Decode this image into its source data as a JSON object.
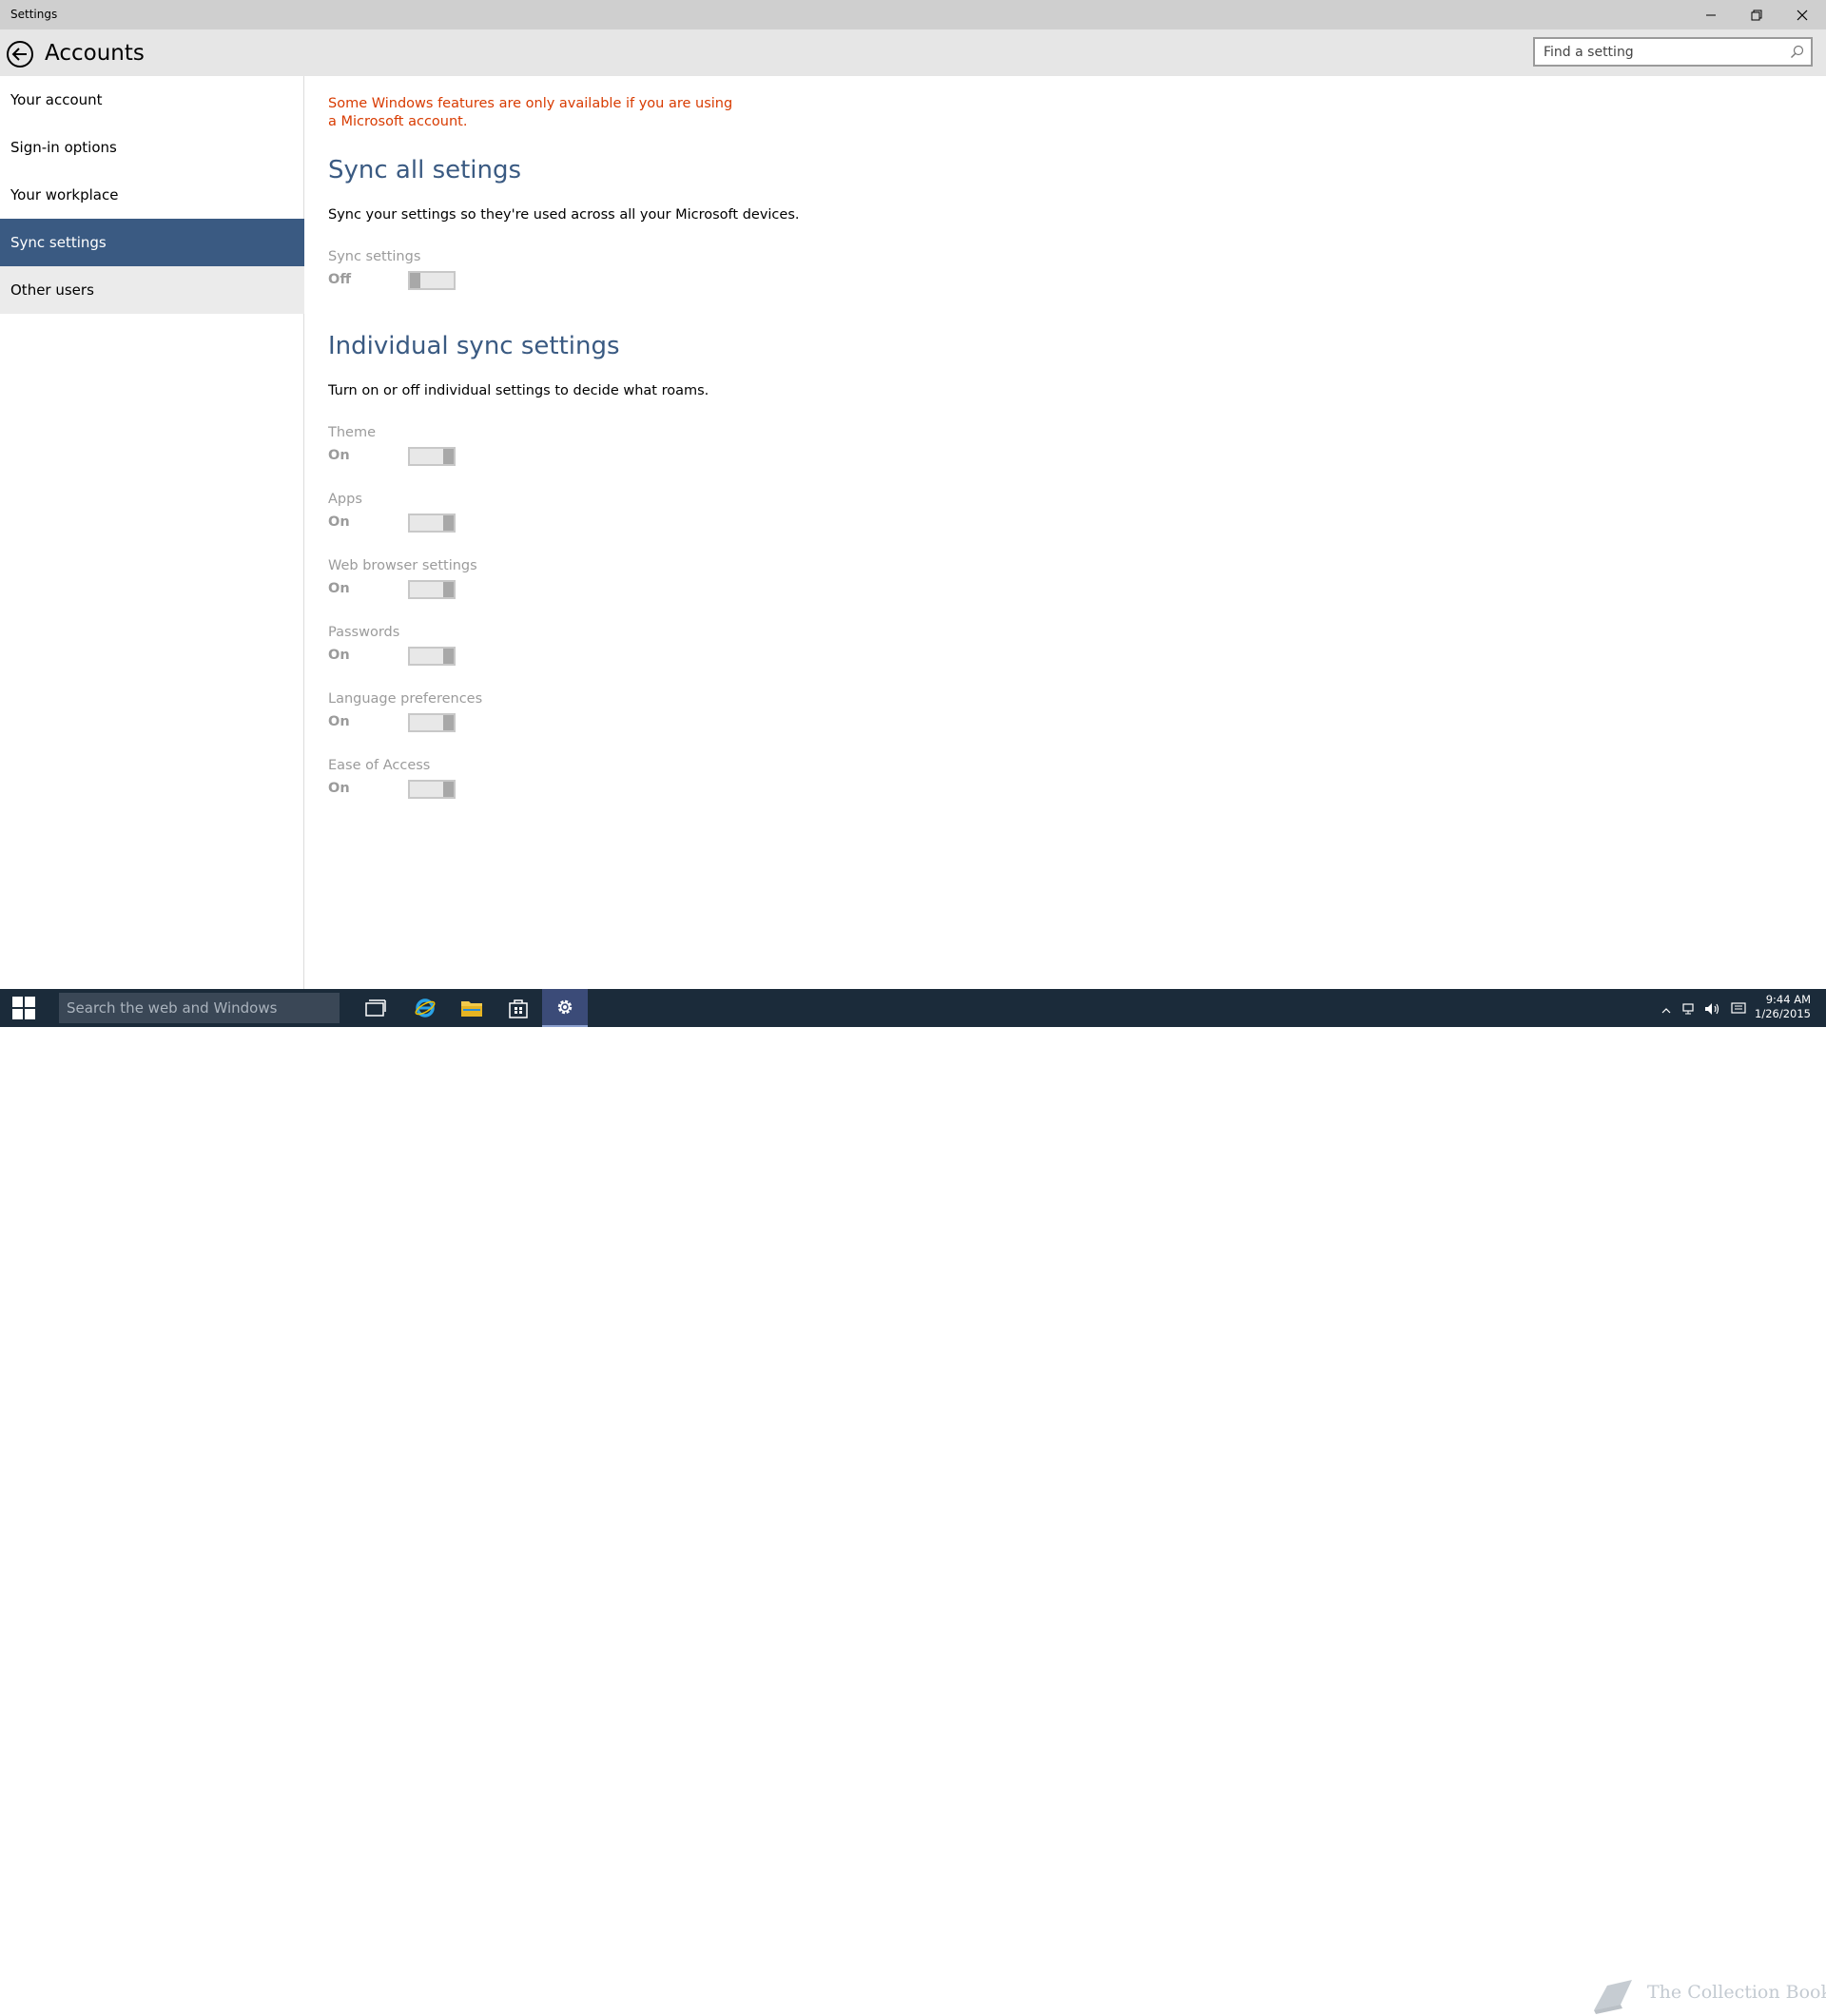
{
  "window": {
    "title": "Settings"
  },
  "header": {
    "title": "Accounts",
    "search_placeholder": "Find a setting"
  },
  "sidebar": {
    "items": [
      {
        "label": "Your account",
        "state": "normal"
      },
      {
        "label": "Sign-in options",
        "state": "normal"
      },
      {
        "label": "Your workplace",
        "state": "normal"
      },
      {
        "label": "Sync settings",
        "state": "selected"
      },
      {
        "label": "Other users",
        "state": "hover"
      }
    ]
  },
  "content": {
    "warning": "Some Windows features are only available if you are using a Microsoft account.",
    "sync_all": {
      "title": "Sync all setings",
      "description": "Sync your settings so they're used across all your Microsoft devices.",
      "setting": {
        "label": "Sync settings",
        "state": "Off",
        "on": false
      }
    },
    "individual": {
      "title": "Individual sync settings",
      "description": "Turn on or off individual settings to decide what roams.",
      "settings": [
        {
          "label": "Theme",
          "state": "On",
          "on": true
        },
        {
          "label": "Apps",
          "state": "On",
          "on": true
        },
        {
          "label": "Web browser settings",
          "state": "On",
          "on": true
        },
        {
          "label": "Passwords",
          "state": "On",
          "on": true
        },
        {
          "label": "Language preferences",
          "state": "On",
          "on": true
        },
        {
          "label": "Ease of Access",
          "state": "On",
          "on": true
        }
      ]
    }
  },
  "taskbar": {
    "search_placeholder": "Search the web and Windows",
    "time": "9:44 AM",
    "date": "1/26/2015",
    "watermark": "The Collection Book",
    "colors": {
      "background": "#1b2b3a",
      "active": "#3b4b78"
    }
  },
  "colors": {
    "accent": "#3a5a82",
    "warning": "#d83b01",
    "disabled_text": "#9b9b9b"
  }
}
